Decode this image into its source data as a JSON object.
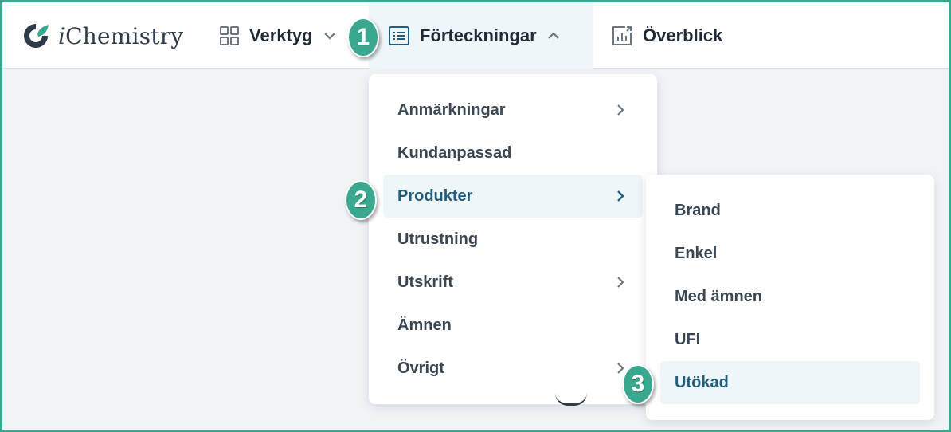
{
  "brand": {
    "name_italic": "i",
    "name_rest": "Chemistry"
  },
  "nav": {
    "verktyg": "Verktyg",
    "forteckningar": "Förteckningar",
    "overblick": "Överblick"
  },
  "badges": [
    "1",
    "2",
    "3"
  ],
  "main_menu": [
    {
      "label": "Anmärkningar",
      "has_submenu": true
    },
    {
      "label": "Kundanpassad",
      "has_submenu": false
    },
    {
      "label": "Produkter",
      "has_submenu": true,
      "active": true
    },
    {
      "label": "Utrustning",
      "has_submenu": false
    },
    {
      "label": "Utskrift",
      "has_submenu": true
    },
    {
      "label": "Ämnen",
      "has_submenu": false
    },
    {
      "label": "Övrigt",
      "has_submenu": true
    }
  ],
  "sub_menu": [
    {
      "label": "Brand"
    },
    {
      "label": "Enkel"
    },
    {
      "label": "Med ämnen"
    },
    {
      "label": "UFI"
    },
    {
      "label": "Utökad",
      "active": true
    }
  ],
  "colors": {
    "accent": "#3aa88f",
    "active_bg": "#eef6fa",
    "active_text": "#1f5f7d"
  }
}
